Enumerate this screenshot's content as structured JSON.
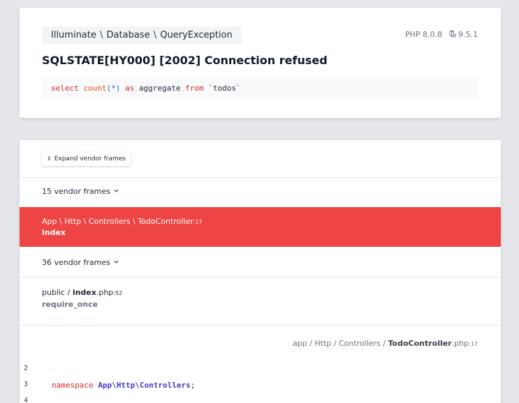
{
  "exception": {
    "class_parts": [
      "Illuminate",
      "Database",
      "QueryException"
    ],
    "message": "SQLSTATE[HY000] [2002] Connection refused",
    "php_version": "PHP 8.0.8",
    "laravel_version": "9.5.1",
    "sql": {
      "select": "select",
      "count": "count",
      "count_args": "(*)",
      "as": "as",
      "alias": "aggregate",
      "from": "from",
      "table": "`todos`"
    }
  },
  "trace": {
    "expand_label": "Expand vendor frames",
    "vendor_group_1": "15 vendor frames",
    "active_frame": {
      "path_parts": [
        "App",
        "Http",
        "Controllers",
        "TodoController"
      ],
      "line": "17",
      "method": "index"
    },
    "vendor_group_2": "36 vendor frames",
    "public_frame": {
      "dir": "public",
      "file_bold": "index",
      "file_ext": ".php",
      "line": "52",
      "method": "require_once"
    },
    "file_crumb": {
      "parts": [
        "app",
        "Http",
        "Controllers"
      ],
      "file_bold": "TodoController",
      "file_ext": ".php",
      "line": "17"
    },
    "code_lines": [
      {
        "num": "2"
      },
      {
        "num": "3",
        "keyword": "namespace",
        "ns": [
          "App",
          "Http",
          "Controllers"
        ],
        "end": ";"
      },
      {
        "num": "4"
      }
    ]
  },
  "colors": {
    "active_frame_bg": "#ef4444",
    "page_bg": "#e5e7eb",
    "keyword": "#dc2626",
    "namespace": "#4338ca"
  }
}
